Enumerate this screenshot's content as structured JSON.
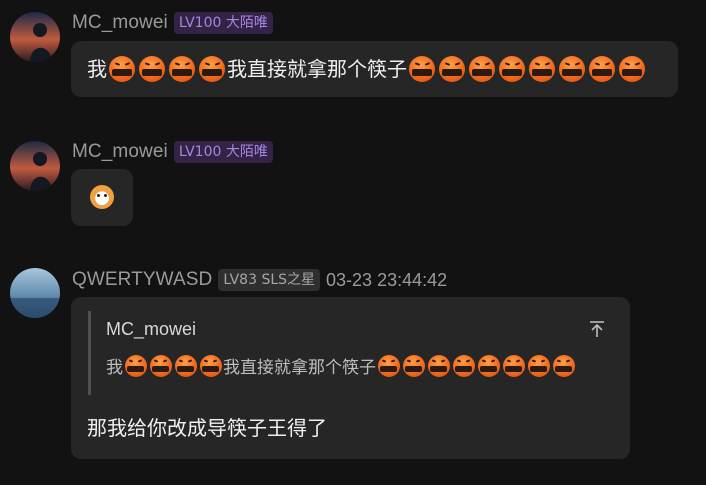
{
  "messages": [
    {
      "username": "MC_mowei",
      "badge": "LV100 大陌唯",
      "text_prefix": "我",
      "text_mid": "我直接就拿那个筷子"
    },
    {
      "username": "MC_mowei",
      "badge": "LV100 大陌唯",
      "sticker": "dog-sticker"
    },
    {
      "username": "QWERTYWASD",
      "badge": "LV83 SLS之星",
      "timestamp": "03-23 23:44:42",
      "quote": {
        "username": "MC_mowei",
        "text_prefix": "我",
        "text_mid": "我直接就拿那个筷子"
      },
      "reply_text": "那我给你改成导筷子王得了"
    }
  ],
  "icons": {
    "emoji": "angry-cursing-emoji",
    "quote_action": "pin-top-icon"
  },
  "colors": {
    "background": "#121212",
    "bubble": "#262626",
    "badge_purple": "#a884e3",
    "badge_gray": "#a6a6a6"
  }
}
